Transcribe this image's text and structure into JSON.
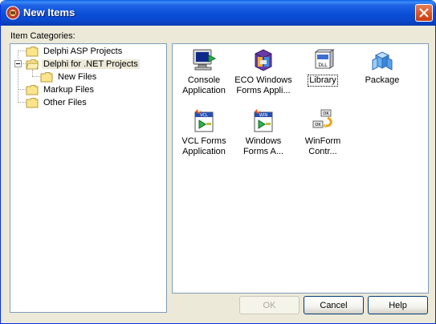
{
  "window": {
    "title": "New Items"
  },
  "categories": {
    "label": "Item Categories:",
    "items": [
      {
        "label": "Delphi ASP Projects"
      },
      {
        "label": "Delphi for .NET Projects"
      },
      {
        "label": "New Files"
      },
      {
        "label": "Markup Files"
      },
      {
        "label": "Other Files"
      }
    ]
  },
  "items": [
    {
      "line1": "Console",
      "line2": "Application",
      "icon": "console-application-icon"
    },
    {
      "line1": "ECO Windows",
      "line2": "Forms Appli...",
      "icon": "eco-windows-forms-icon"
    },
    {
      "line1": "Library",
      "line2": "",
      "icon": "library-dll-icon"
    },
    {
      "line1": "Package",
      "line2": "",
      "icon": "package-icon"
    },
    {
      "line1": "VCL Forms",
      "line2": "Application",
      "icon": "vcl-forms-icon"
    },
    {
      "line1": "Windows",
      "line2": "Forms A...",
      "icon": "windows-forms-icon"
    },
    {
      "line1": "WinForm",
      "line2": "Contr...",
      "icon": "winform-control-icon"
    }
  ],
  "buttons": {
    "ok": "OK",
    "cancel": "Cancel",
    "help": "Help"
  },
  "colors": {
    "titlebar": "#0a4fd6",
    "face": "#ece9d8",
    "panel_border": "#7f9db9",
    "close": "#d9501f"
  }
}
